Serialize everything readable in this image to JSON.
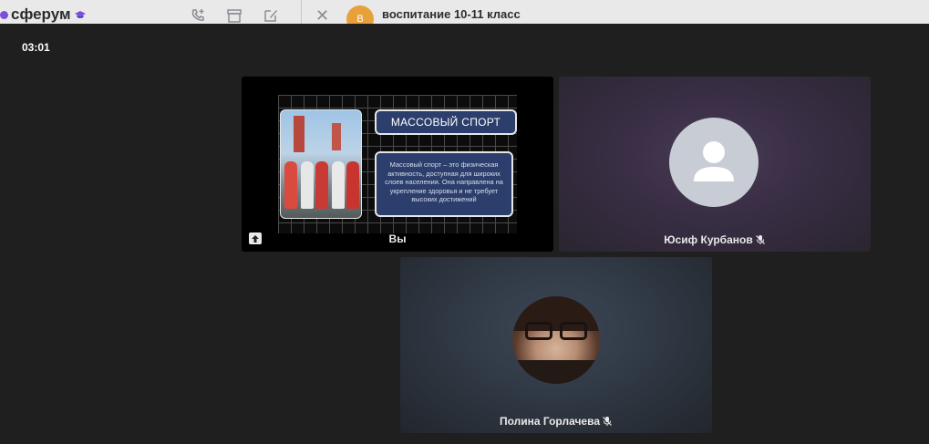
{
  "app": {
    "brand": "сферум",
    "chat_title": "воспитание 10-11 класс",
    "chat_avatar_letter": "В"
  },
  "call": {
    "timer": "03:01",
    "participants": [
      {
        "name": "Вы",
        "muted": false,
        "sharing_screen": true
      },
      {
        "name": "Юсиф Курбанов",
        "muted": true,
        "has_photo": false
      },
      {
        "name": "Полина Горлачева",
        "muted": true,
        "has_photo": true
      }
    ]
  },
  "slide": {
    "title": "МАССОВЫЙ СПОРТ",
    "body": "Массовый спорт – это физическая активность, доступная для широких слоев населения. Она направлена на укрепление здоровья и не требует высоких достижений"
  },
  "colors": {
    "overlay_bg": "#1f1f1f",
    "brand_accent": "#7b4fe0",
    "slide_box": "#2c3e6b"
  }
}
